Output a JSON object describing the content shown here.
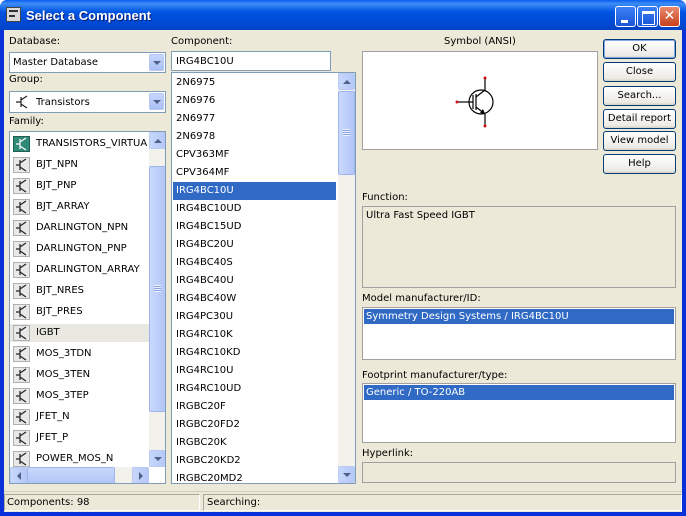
{
  "window": {
    "title": "Select a Component"
  },
  "database": {
    "label": "Database:",
    "value": "Master Database"
  },
  "group": {
    "label": "Group:",
    "value": "Transistors"
  },
  "family": {
    "label": "Family:",
    "items": [
      {
        "label": "TRANSISTORS_VIRTUA",
        "icon": "virtual-transistor-icon"
      },
      {
        "label": "BJT_NPN",
        "icon": "bjt-npn-icon"
      },
      {
        "label": "BJT_PNP",
        "icon": "bjt-pnp-icon"
      },
      {
        "label": "BJT_ARRAY",
        "icon": "bjt-array-icon"
      },
      {
        "label": "DARLINGTON_NPN",
        "icon": "darlington-npn-icon"
      },
      {
        "label": "DARLINGTON_PNP",
        "icon": "darlington-pnp-icon"
      },
      {
        "label": "DARLINGTON_ARRAY",
        "icon": "darlington-array-icon"
      },
      {
        "label": "BJT_NRES",
        "icon": "bjt-nres-icon"
      },
      {
        "label": "BJT_PRES",
        "icon": "bjt-pres-icon"
      },
      {
        "label": "IGBT",
        "icon": "igbt-icon"
      },
      {
        "label": "MOS_3TDN",
        "icon": "mos-3tdn-icon"
      },
      {
        "label": "MOS_3TEN",
        "icon": "mos-3ten-icon"
      },
      {
        "label": "MOS_3TEP",
        "icon": "mos-3tep-icon"
      },
      {
        "label": "JFET_N",
        "icon": "jfet-n-icon"
      },
      {
        "label": "JFET_P",
        "icon": "jfet-p-icon"
      },
      {
        "label": "POWER_MOS_N",
        "icon": "power-mos-n-icon"
      }
    ],
    "highlighted": "IGBT"
  },
  "component": {
    "label": "Component:",
    "value": "IRG4BC10U",
    "items": [
      "2N6975",
      "2N6976",
      "2N6977",
      "2N6978",
      "CPV363MF",
      "CPV364MF",
      "IRG4BC10U",
      "IRG4BC10UD",
      "IRG4BC15UD",
      "IRG4BC20U",
      "IRG4BC40S",
      "IRG4BC40U",
      "IRG4BC40W",
      "IRG4PC30U",
      "IRG4RC10K",
      "IRG4RC10KD",
      "IRG4RC10U",
      "IRG4RC10UD",
      "IRGBC20F",
      "IRGBC20FD2",
      "IRGBC20K",
      "IRGBC20KD2",
      "IRGBC20MD2"
    ],
    "selected": "IRG4BC10U"
  },
  "symbol": {
    "label": "Symbol (ANSI)",
    "icon": "igbt-symbol-icon"
  },
  "buttons": {
    "ok": "OK",
    "close": "Close",
    "search": "Search...",
    "detail_report": "Detail report",
    "view_model": "View model",
    "help": "Help"
  },
  "function": {
    "label": "Function:",
    "value": "Ultra Fast Speed IGBT"
  },
  "model_manufacturer": {
    "label": "Model manufacturer/ID:",
    "value": "Symmetry Design Systems / IRG4BC10U"
  },
  "footprint": {
    "label": "Footprint manufacturer/type:",
    "value": "Generic / TO-220AB"
  },
  "hyperlink": {
    "label": "Hyperlink:",
    "value": ""
  },
  "status": {
    "components": "Components: 98",
    "searching": "Searching:"
  },
  "colors": {
    "selection": "#316ac5",
    "titlebar": "#0054e3",
    "dialog": "#ece9d8"
  }
}
